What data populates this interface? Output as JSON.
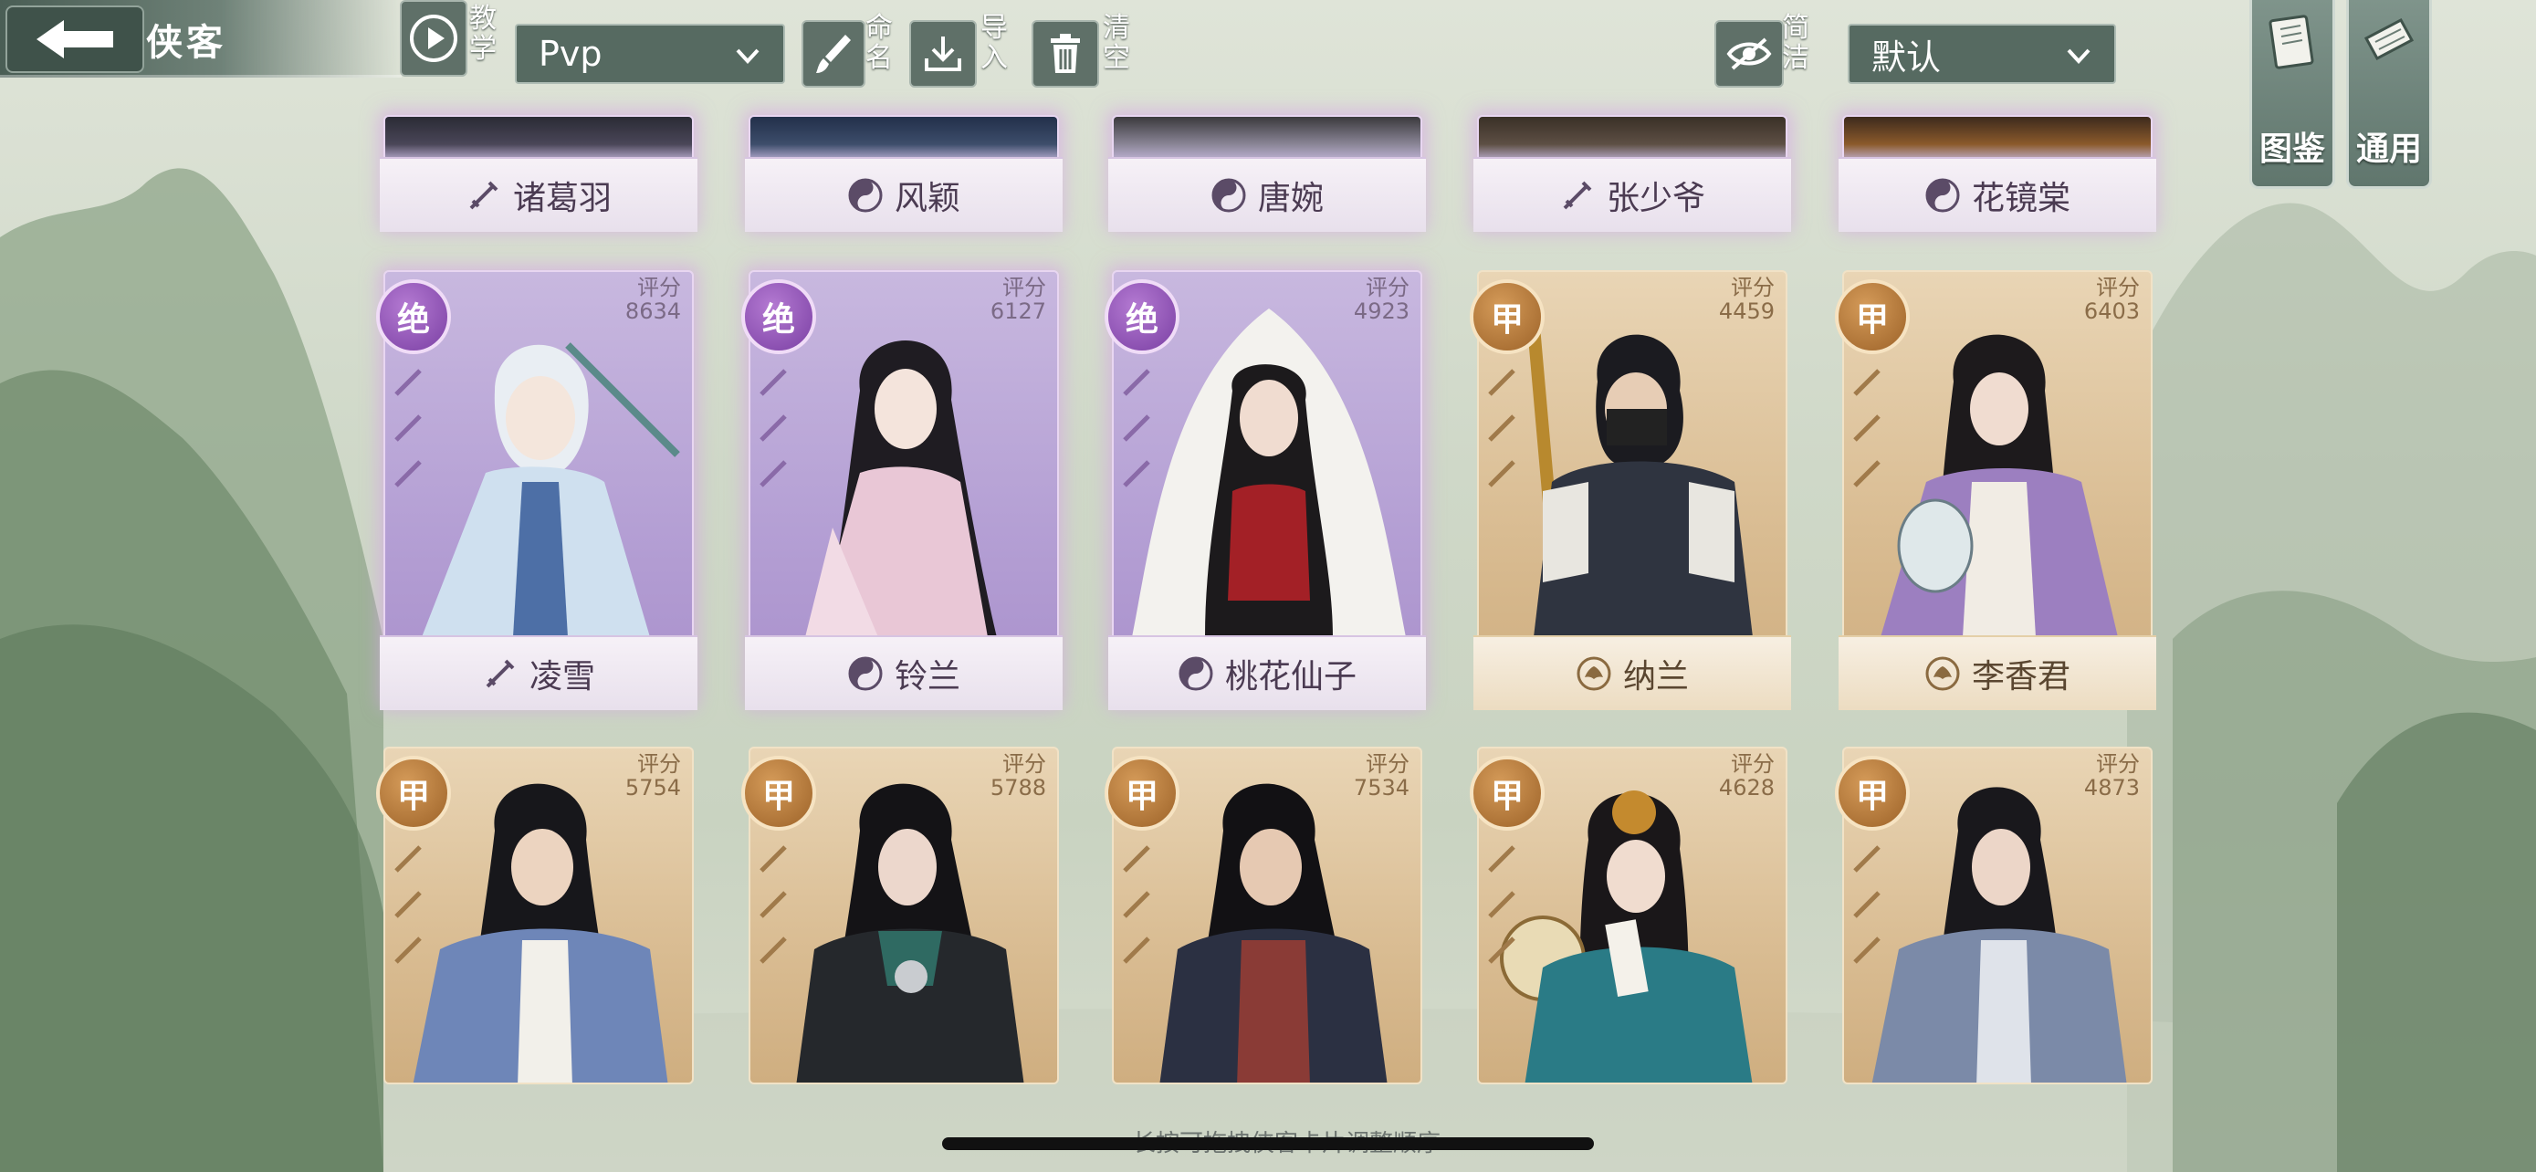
{
  "header": {
    "title": "侠客",
    "tutorial_label": "教学",
    "mode_select": "Pvp",
    "rename_label": "命名",
    "import_label": "导入",
    "clear_label": "清空",
    "simple_label": "简洁",
    "sort_select": "默认",
    "codex_tab": "图鉴",
    "general_tab": "通用"
  },
  "colors": {
    "jue_badge": "#7a3fa3",
    "jia_badge": "#9c6228",
    "topbar": "#566a61"
  },
  "score_label": "评分",
  "top_row": [
    {
      "name": "诸葛羽",
      "icon": "sword-icon"
    },
    {
      "name": "风颖",
      "icon": "taiji-icon"
    },
    {
      "name": "唐婉",
      "icon": "taiji-icon"
    },
    {
      "name": "张少爷",
      "icon": "sword-icon"
    },
    {
      "name": "花镜棠",
      "icon": "taiji-icon"
    }
  ],
  "middle_row": [
    {
      "name": "凌雪",
      "grade": "绝",
      "score": "8634",
      "icon": "sword-icon"
    },
    {
      "name": "铃兰",
      "grade": "绝",
      "score": "6127",
      "icon": "taiji-icon"
    },
    {
      "name": "桃花仙子",
      "grade": "绝",
      "score": "4923",
      "icon": "taiji-icon"
    },
    {
      "name": "纳兰",
      "grade": "甲",
      "score": "4459",
      "icon": "lotus-icon"
    },
    {
      "name": "李香君",
      "grade": "甲",
      "score": "6403",
      "icon": "lotus-icon"
    }
  ],
  "bottom_row": [
    {
      "grade": "甲",
      "score": "5754"
    },
    {
      "grade": "甲",
      "score": "5788"
    },
    {
      "grade": "甲",
      "score": "7534"
    },
    {
      "grade": "甲",
      "score": "4628"
    },
    {
      "grade": "甲",
      "score": "4873"
    }
  ],
  "footer_hint": "长按可拖拽侠客卡片调整顺序"
}
